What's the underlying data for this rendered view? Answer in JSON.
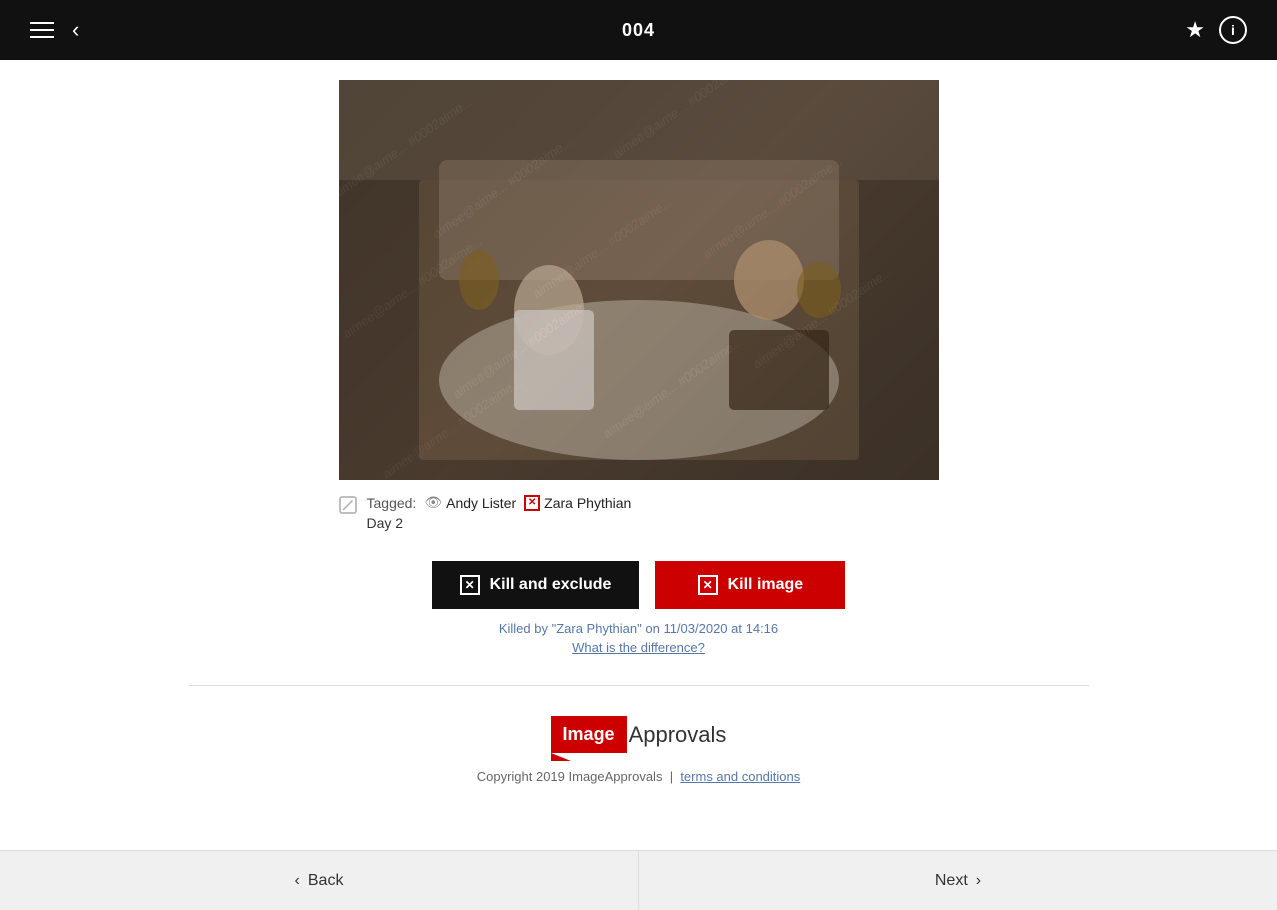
{
  "header": {
    "page_number": "004",
    "hamburger_label": "menu",
    "back_label": "back",
    "star_label": "favorite",
    "info_label": "info"
  },
  "image": {
    "alt": "Photo 004 - two people on bed",
    "watermark": "aimee@aime... #0002aime..."
  },
  "tags": {
    "label": "Tagged:",
    "people": [
      {
        "name": "Andy Lister",
        "has_eye": true,
        "has_x": false
      },
      {
        "name": "Zara Phythian",
        "has_eye": false,
        "has_x": true
      }
    ],
    "day": "Day 2"
  },
  "buttons": {
    "kill_exclude_label": "Kill and exclude",
    "kill_image_label": "Kill image"
  },
  "killed_info": {
    "text": "Killed by \"Zara Phythian\" on 11/03/2020 at 14:16",
    "link_text": "What is the difference?"
  },
  "logo": {
    "image_part": "Image",
    "approvals_part": "Approvals"
  },
  "footer": {
    "copyright": "Copyright 2019 ImageApprovals",
    "separator": "|",
    "terms_label": "terms and conditions"
  },
  "bottom_nav": {
    "back_label": "Back",
    "next_label": "Next"
  }
}
